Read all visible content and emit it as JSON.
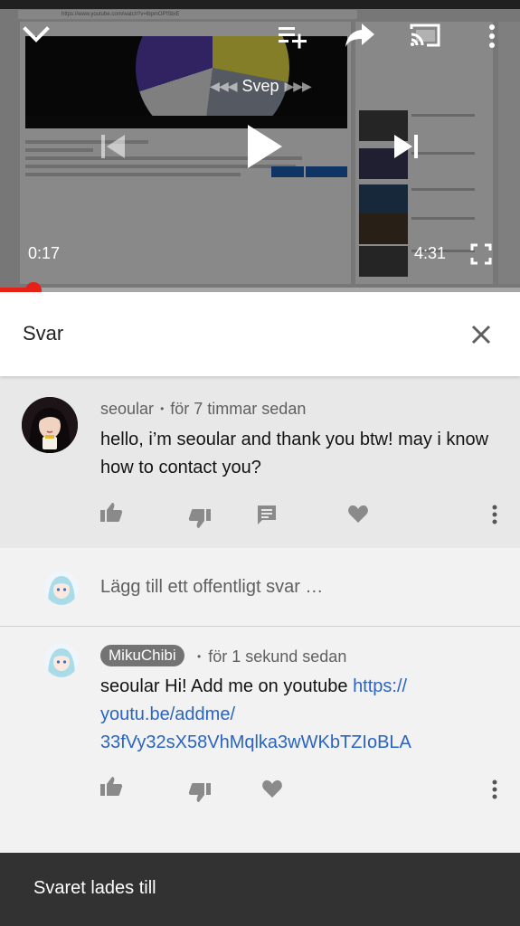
{
  "player": {
    "browser_url": "https://www.youtube.com/watch?v=lbpmOPfSbrE",
    "gesture_label": "Svep",
    "elapsed": "0:17",
    "duration": "4:31",
    "progress_fraction": 0.065
  },
  "replies_panel": {
    "title": "Svar"
  },
  "original_comment": {
    "author": "seoular",
    "separator": "•",
    "time": "för 7 timmar sedan",
    "text": "hello, i’m seoular and thank you btw! may i know how to contact you?"
  },
  "reply_box": {
    "placeholder": "Lägg till ett offentligt svar …"
  },
  "reply": {
    "author": "MikuChibi",
    "separator": "•",
    "time": "för 1 sekund sedan",
    "text_prefix": "seoular Hi! Add me on youtube ",
    "link_line1": "https://",
    "link_line2": "youtu.be/addme/",
    "link_line3": "33fVy32sX58VhMqlka3wWKbTZIoBLA"
  },
  "snackbar": {
    "message": "Svaret lades till"
  },
  "colors": {
    "accent_red": "#e62117",
    "link_blue": "#2a64c3",
    "snackbar_bg": "#323232"
  },
  "icons": [
    "chevron-down-icon",
    "add-to-queue-icon",
    "share-icon",
    "cast-icon",
    "more-vert-icon",
    "previous-icon",
    "play-icon",
    "next-icon",
    "fullscreen-icon",
    "close-icon",
    "thumb-up-icon",
    "thumb-down-icon",
    "reply-icon",
    "heart-icon"
  ]
}
